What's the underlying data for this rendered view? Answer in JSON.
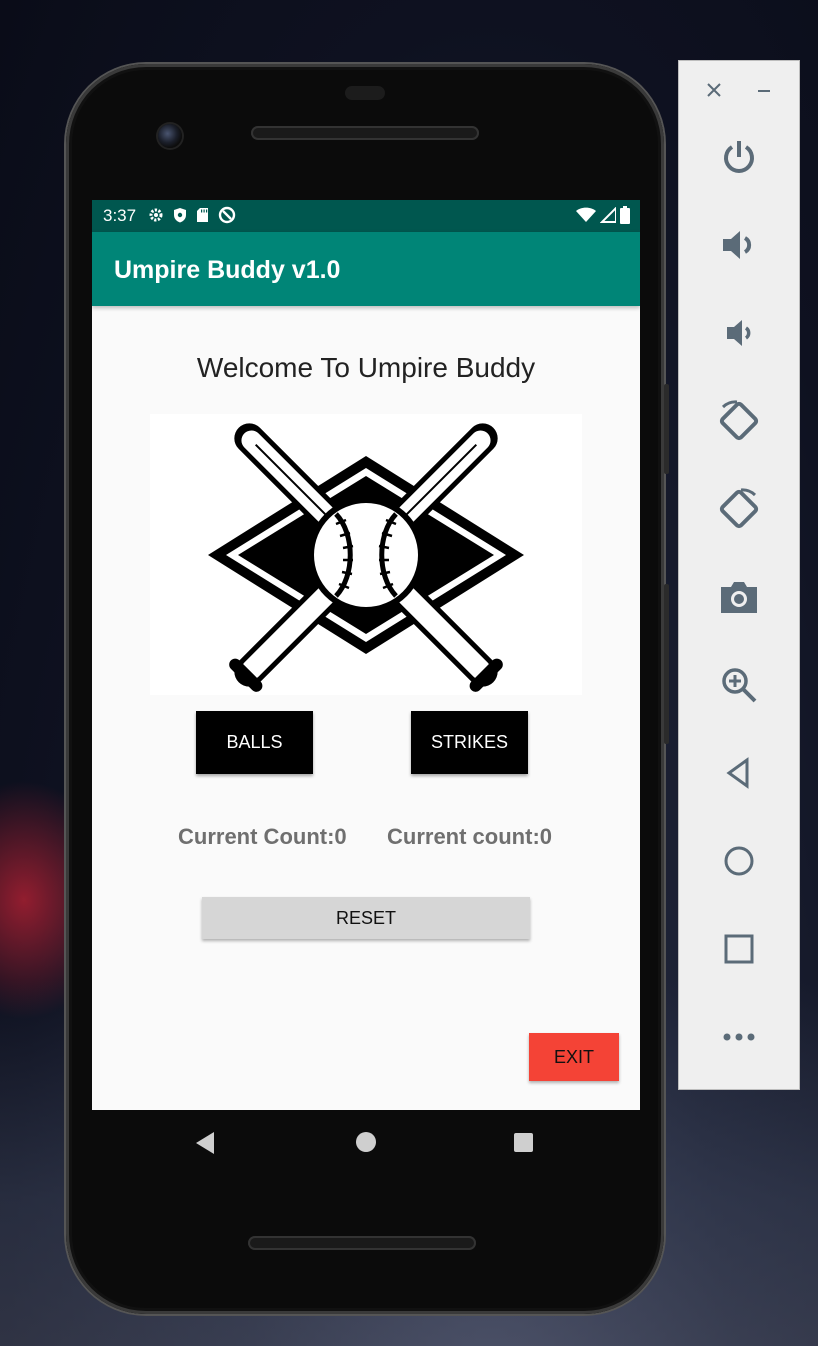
{
  "status_bar": {
    "time": "3:37",
    "left_icons": [
      "settings-icon",
      "shield-icon",
      "sd-card-icon",
      "data-saver-icon"
    ],
    "right_icons": [
      "wifi-icon",
      "signal-icon",
      "battery-icon"
    ]
  },
  "app_bar": {
    "title": "Umpire Buddy v1.0"
  },
  "main": {
    "welcome": "Welcome To Umpire Buddy",
    "logo_icon": "crossed-bats-baseball-logo",
    "balls_label": "BALLS",
    "strikes_label": "STRIKES",
    "balls_count": "Current Count:0",
    "strikes_count": "Current count:0",
    "reset_label": "RESET",
    "exit_label": "EXIT"
  },
  "nav": [
    "back-icon",
    "home-icon",
    "recents-icon"
  ],
  "emulator_panel": {
    "window_controls": [
      "close-icon",
      "minimize-icon"
    ],
    "tools": [
      "power-icon",
      "volume-up-icon",
      "volume-down-icon",
      "rotate-left-icon",
      "rotate-right-icon",
      "camera-icon",
      "zoom-icon",
      "back-icon",
      "home-icon",
      "overview-icon",
      "more-icon"
    ]
  },
  "colors": {
    "app_bar": "#008577",
    "status_bar": "#00574f",
    "exit_button": "#f44336",
    "count_text": "#6f6f6f"
  }
}
